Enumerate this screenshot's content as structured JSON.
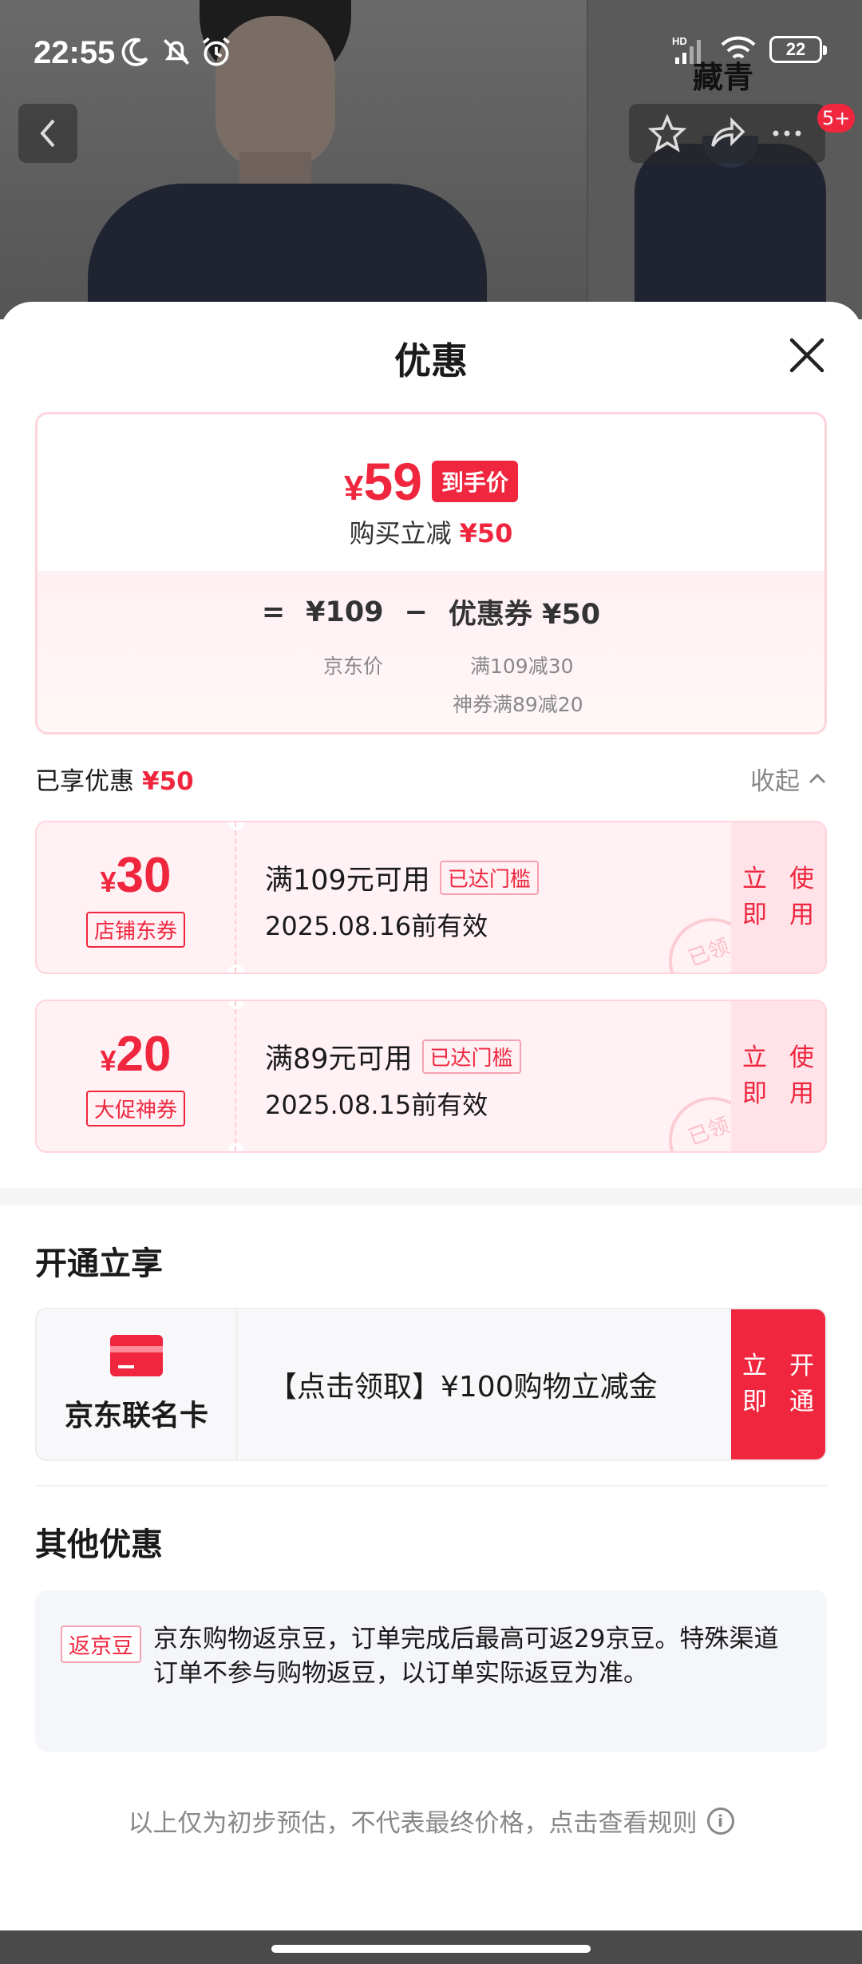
{
  "status": {
    "time": "22:55",
    "battery": "22"
  },
  "backdrop": {
    "brand_mark": "藏青",
    "badge": "5+"
  },
  "sheet": {
    "title": "优惠"
  },
  "summary": {
    "currency": "¥",
    "final_price": "59",
    "price_tag": "到手价",
    "save_label": "购买立减",
    "save_amount": "¥50",
    "eq": "=",
    "jd_price": "¥109",
    "minus": "−",
    "coupon_total": "优惠券 ¥50",
    "jd_price_label": "京东价",
    "coupon_detail_1": "满109减30",
    "coupon_detail_2": "神券满89减20"
  },
  "enjoyed": {
    "label": "已享优惠",
    "amount": "¥50",
    "collapse": "收起"
  },
  "coupons": [
    {
      "currency": "¥",
      "amount": "30",
      "type": "店铺东券",
      "condition": "满109元可用",
      "reached": "已达门槛",
      "valid": "2025.08.16前有效",
      "btn_l1": "立即",
      "btn_l2": "使用",
      "stamp": "已领"
    },
    {
      "currency": "¥",
      "amount": "20",
      "type": "大促神券",
      "condition": "满89元可用",
      "reached": "已达门槛",
      "valid": "2025.08.15前有效",
      "btn_l1": "立即",
      "btn_l2": "使用",
      "stamp": "已领"
    }
  ],
  "open_section": {
    "title": "开通立享",
    "card_name": "京东联名卡",
    "offer": "【点击领取】¥100购物立减金",
    "btn_l1": "立即",
    "btn_l2": "开通"
  },
  "other_section": {
    "title": "其他优惠",
    "tag": "返京豆",
    "text": "京东购物返京豆，订单完成后最高可返29京豆。特殊渠道订单不参与购物返豆，以订单实际返豆为准。"
  },
  "disclaimer": "以上仅为初步预估，不代表最终价格，点击查看规则",
  "colors": {
    "accent": "#f0263f",
    "coupon_bg": "#fff1f4",
    "muted": "#888888"
  }
}
